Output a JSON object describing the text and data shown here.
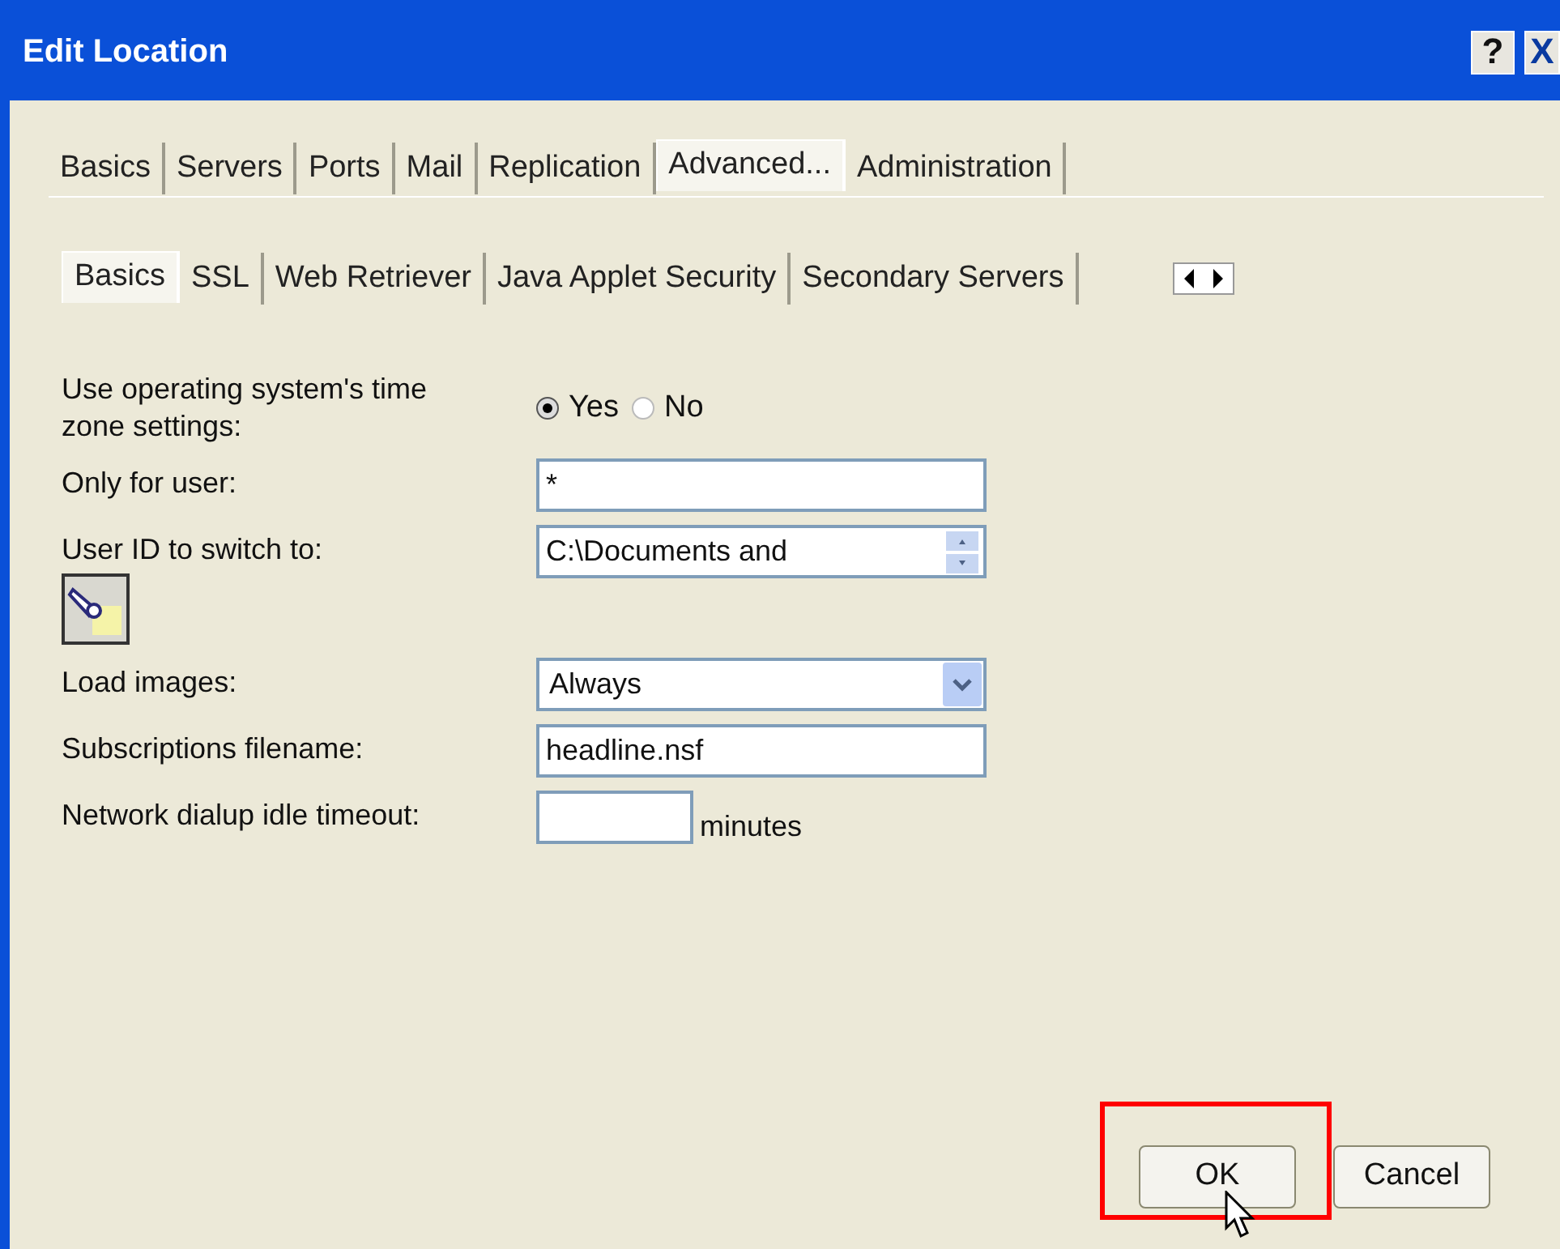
{
  "window": {
    "title": "Edit Location",
    "help_button": "?",
    "close_button": "X"
  },
  "tabs": [
    {
      "label": "Basics",
      "selected": false
    },
    {
      "label": "Servers",
      "selected": false
    },
    {
      "label": "Ports",
      "selected": false
    },
    {
      "label": "Mail",
      "selected": false
    },
    {
      "label": "Replication",
      "selected": false
    },
    {
      "label": "Advanced...",
      "selected": true
    },
    {
      "label": "Administration",
      "selected": false
    }
  ],
  "subtabs": [
    {
      "label": "Basics",
      "selected": true
    },
    {
      "label": "SSL",
      "selected": false
    },
    {
      "label": "Web Retriever",
      "selected": false
    },
    {
      "label": "Java Applet Security",
      "selected": false
    },
    {
      "label": "Secondary Servers",
      "selected": false
    }
  ],
  "fields": [
    {
      "kind": "radio",
      "label": "Use operating system's time zone settings:",
      "options": [
        {
          "label": "Yes",
          "selected": true
        },
        {
          "label": "No",
          "selected": false
        }
      ]
    },
    {
      "kind": "text",
      "label": "Only for user:",
      "value": "*"
    },
    {
      "kind": "spin",
      "label": "User ID to switch to:",
      "value": "C:\\Documents and"
    },
    {
      "kind": "select",
      "label": "Load images:",
      "value": "Always"
    },
    {
      "kind": "text",
      "label": "Subscriptions filename:",
      "value": "headline.nsf"
    },
    {
      "kind": "short",
      "label": "Network dialup idle timeout:",
      "suffix": "minutes"
    }
  ],
  "buttons": [
    {
      "label": "OK",
      "highlighted": true
    },
    {
      "label": "Cancel",
      "highlighted": false
    }
  ]
}
